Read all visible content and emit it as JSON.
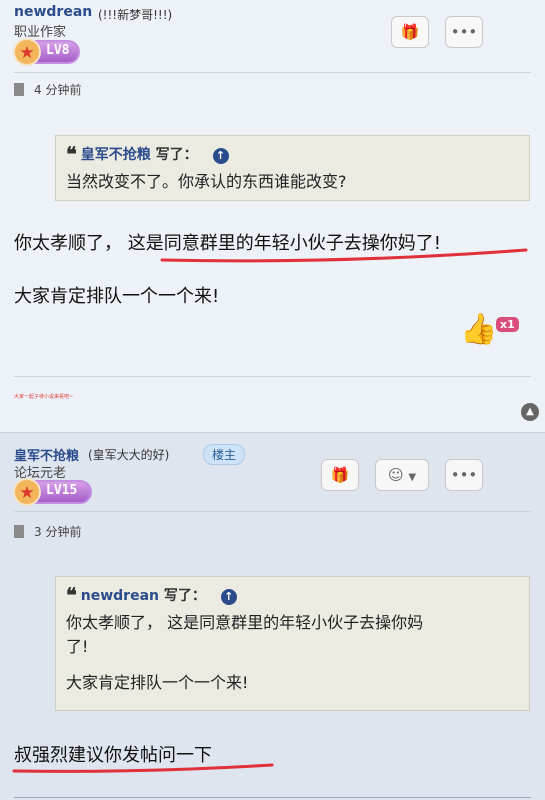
{
  "post1": {
    "username": "newdrean",
    "user_title": "(!!!新梦哥!!!)",
    "rank": "职业作家",
    "level": "LV8",
    "time": "4 分钟前",
    "quote": {
      "author": "皇军不抢粮",
      "wrote": "写了：",
      "text": "当然改变不了。你承认的东西谁能改变?"
    },
    "line1": "你太孝顺了，  这是同意群里的年轻小伙子去操你妈了!",
    "line2": "大家肯定排队一个一个来!",
    "like_count": "x1",
    "signature": "大家一起子待小说来看吧~",
    "icons": {
      "gift": "gift-icon",
      "more": "more-icon",
      "like": "thumbs-up-icon",
      "top": "scroll-top-icon",
      "time": "document-icon"
    }
  },
  "post2": {
    "username": "皇军不抢粮",
    "user_title": "(皇军大大的好)",
    "owner_badge": "楼主",
    "rank": "论坛元老",
    "level": "LV15",
    "time": "3 分钟前",
    "quote": {
      "author": "newdrean",
      "wrote": "写了：",
      "text_line1": "你太孝顺了，  这是同意群里的年轻小伙子去操你妈",
      "text_line2": "了!",
      "text_line3": "大家肯定排队一个一个来!"
    },
    "line1": "叔强烈建议你发帖问一下",
    "icons": {
      "gift": "gift-icon",
      "emoji": "smiley-icon",
      "more": "more-icon",
      "time": "document-icon"
    }
  },
  "colors": {
    "username": "#2b4c8c",
    "underline": "#e0303a",
    "badge": "#d94d7b"
  }
}
